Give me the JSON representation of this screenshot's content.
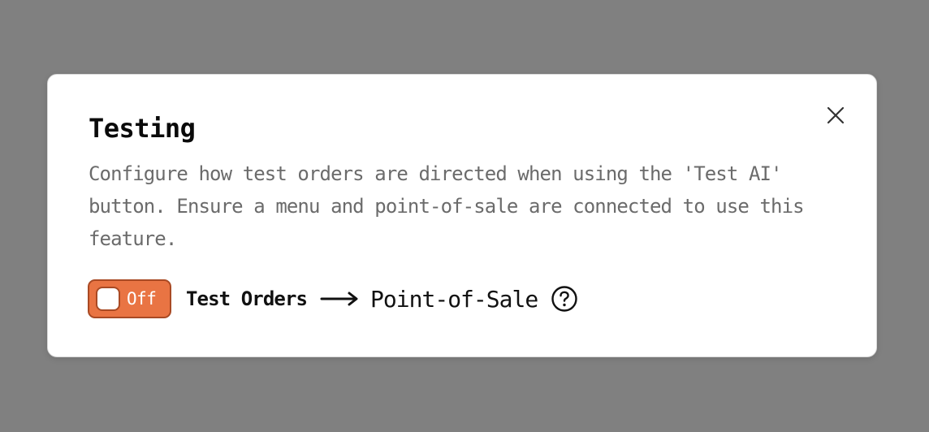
{
  "modal": {
    "title": "Testing",
    "description": "Configure how test orders are directed when using the 'Test AI' button. Ensure a menu and point-of-sale are connected to use this feature."
  },
  "toggle": {
    "state_label": "Off",
    "checked": false
  },
  "routing": {
    "source_label": "Test Orders",
    "destination_label": "Point-of-Sale"
  },
  "icons": {
    "close": "close-icon",
    "arrow": "arrow-right-icon",
    "help": "question-circle-icon"
  },
  "colors": {
    "backdrop": "#808080",
    "toggle_background": "#e97443",
    "toggle_border": "#a94a24",
    "description_text": "#6b6b6b"
  }
}
